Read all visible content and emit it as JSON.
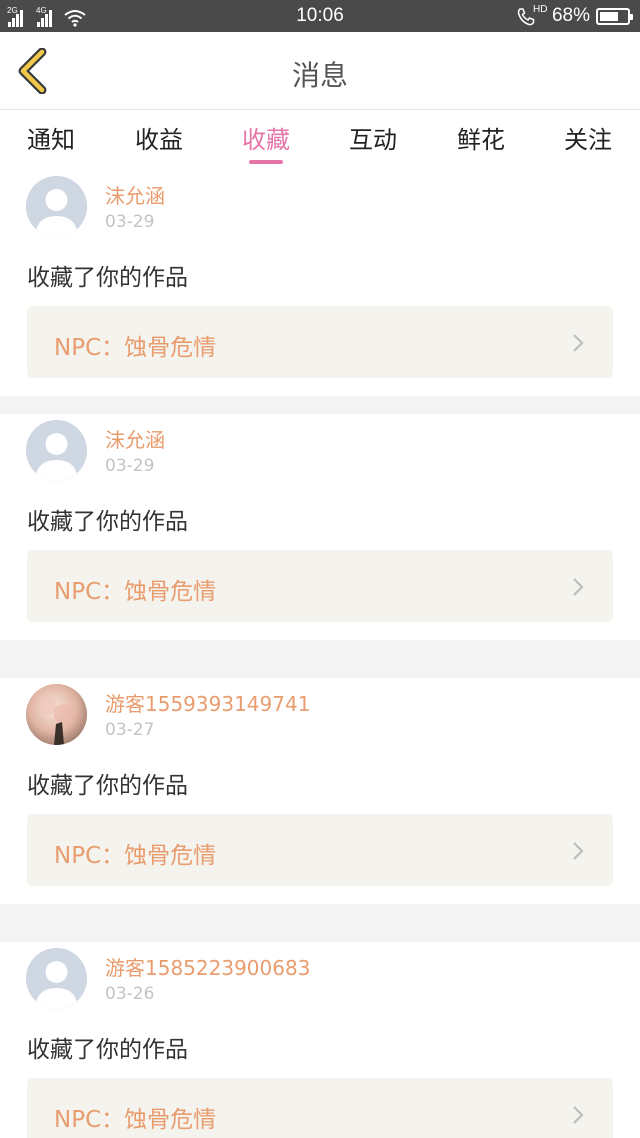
{
  "status_bar": {
    "sim1_gen": "2G",
    "sim2_gen": "4G",
    "time": "10:06",
    "hd_label": "HD",
    "battery_percent": "68%",
    "battery_level": 0.68
  },
  "header": {
    "title": "消息",
    "back_icon": "chevron-left-icon"
  },
  "tabs": [
    {
      "label": "通知",
      "active": false
    },
    {
      "label": "收益",
      "active": false
    },
    {
      "label": "收藏",
      "active": true
    },
    {
      "label": "互动",
      "active": false
    },
    {
      "label": "鲜花",
      "active": false
    },
    {
      "label": "关注",
      "active": false
    }
  ],
  "colors": {
    "accent": "#e575a8",
    "username": "#e99c6e",
    "date": "#c3c3c3",
    "card_link_bg": "#f4f3ee",
    "divider": "#f4f4f4"
  },
  "messages": [
    {
      "username": "沫允涵",
      "date": "03-29",
      "action": "收藏了你的作品",
      "work_title": "NPC：蚀骨危情",
      "avatar": "default-avatar"
    },
    {
      "username": "沫允涵",
      "date": "03-29",
      "action": "收藏了你的作品",
      "work_title": "NPC：蚀骨危情",
      "avatar": "default-avatar"
    },
    {
      "username": "游客1559393149741",
      "date": "03-27",
      "action": "收藏了你的作品",
      "work_title": "NPC：蚀骨危情",
      "avatar": "photo-avatar"
    },
    {
      "username": "游客1585223900683",
      "date": "03-26",
      "action": "收藏了你的作品",
      "work_title": "NPC：蚀骨危情",
      "avatar": "default-avatar"
    }
  ]
}
